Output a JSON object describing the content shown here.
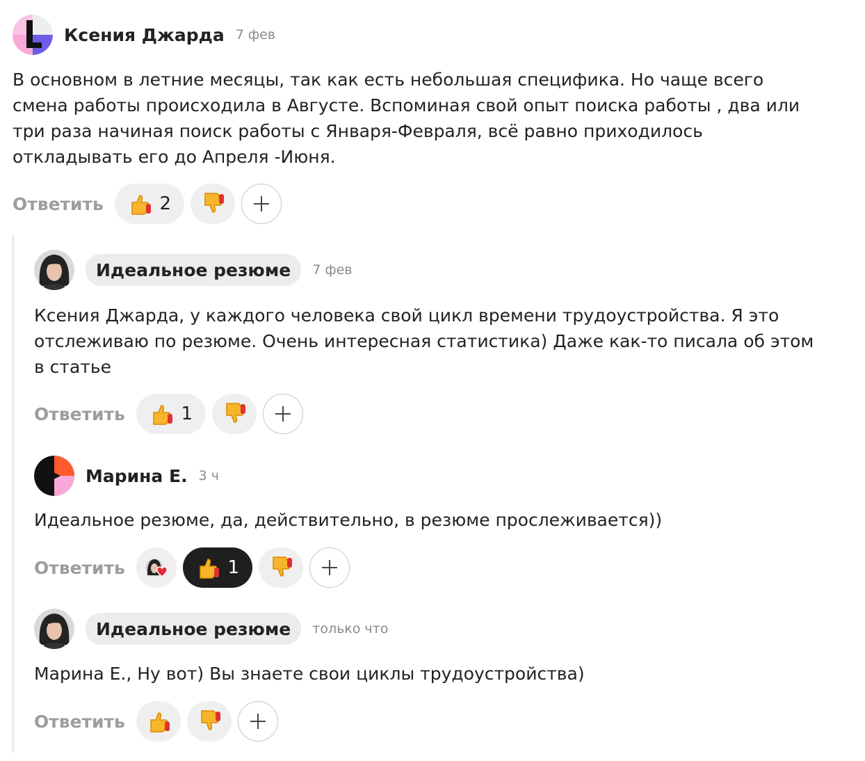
{
  "comments": [
    {
      "author": "Ксения Джарда",
      "time": "7 фев",
      "lines": [
        "В основном в летние месяцы, так как есть небольшая специфика. Но чаще всего",
        "смена работы происходила в Августе. Вспоминая свой опыт поиска работы , два или",
        "три раза начиная поиск работы с Января-Февраля, всё равно приходилось",
        "откладывать его до Апреля -Июня."
      ],
      "reply_label": "Ответить",
      "likes": "2"
    },
    {
      "author": "Идеальное резюме",
      "time": "7 фев",
      "lines": [
        "Ксения Джарда, у каждого человека свой цикл времени трудоустройства. Я это",
        "отслеживаю по резюме. Очень интересная статистика) Даже как-то писала об этом",
        "в статье"
      ],
      "reply_label": "Ответить",
      "likes": "1"
    },
    {
      "author": "Марина Е.",
      "time": "3 ч",
      "lines": [
        "Идеальное резюме, да, действительно, в резюме прослеживается))"
      ],
      "reply_label": "Ответить",
      "likes": "1"
    },
    {
      "author": "Идеальное резюме",
      "time": "только что",
      "lines": [
        "Марина Е., Ну вот) Вы знаете свои циклы трудоустройства)"
      ],
      "reply_label": "Ответить"
    }
  ],
  "icons": {
    "like": "thumbs-up-icon",
    "dislike": "thumbs-down-icon",
    "add": "plus-icon",
    "reacted": "avatar-with-heart-icon"
  },
  "colors": {
    "active_pill": "#1f1f1f",
    "pill": "#efefef",
    "chip": "#ececec",
    "reply": "#9d9d9d",
    "time": "#8a8a8a",
    "avatar_purple": "#6c5ce7",
    "avatar_orange": "#ff5a2c",
    "avatar_pink": "#f7a8d8"
  }
}
